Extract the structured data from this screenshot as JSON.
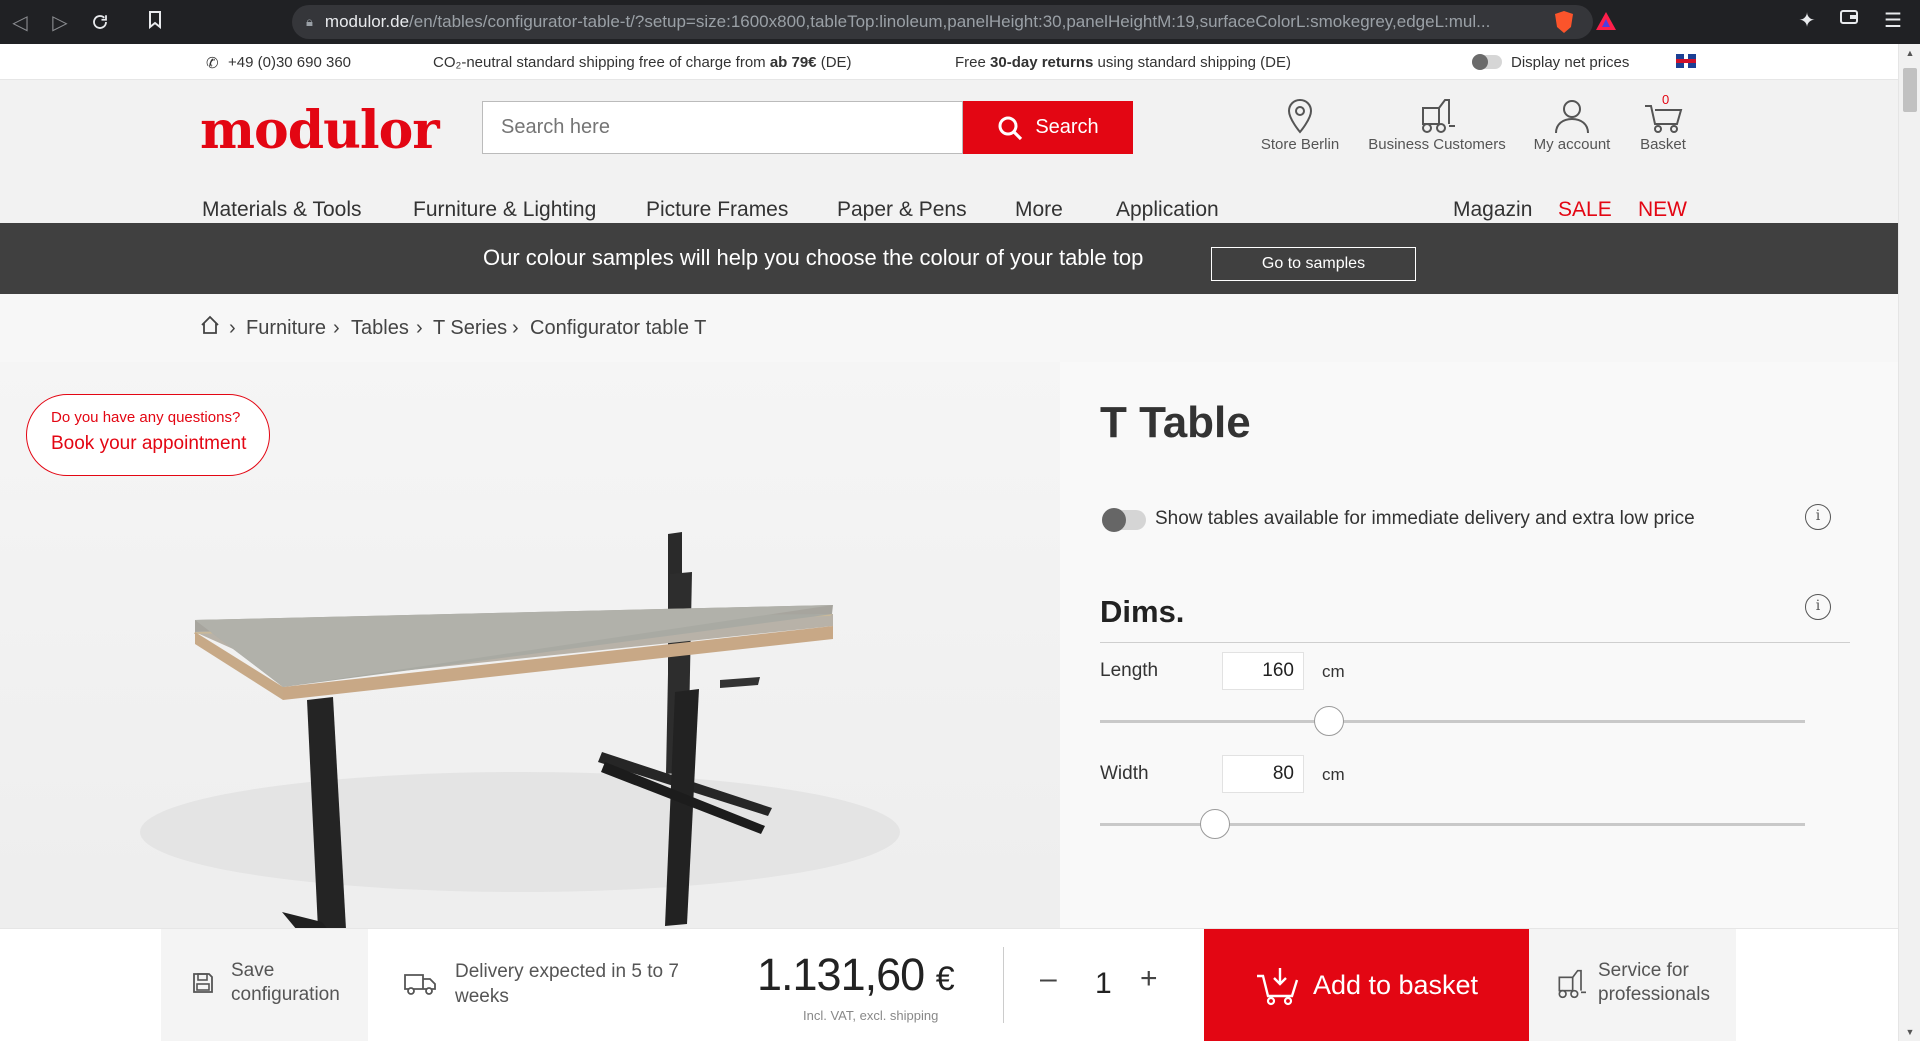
{
  "browser": {
    "url_host": "modulor.de",
    "url_path": "/en/tables/configurator-table-t/?setup=size:1600x800,tableTop:linoleum,panelHeight:30,panelHeightM:19,surfaceColorL:smokegrey,edgeL:mul..."
  },
  "topbar": {
    "phone": "+49 (0)30 690 360",
    "shipping_pre": "CO₂-neutral standard shipping free of charge from ",
    "shipping_bold": "ab 79€",
    "shipping_post": " (DE)",
    "returns_pre": "Free ",
    "returns_bold": "30-day returns",
    "returns_post": " using standard shipping (DE)",
    "net_prices": "Display net prices"
  },
  "header": {
    "logo": "modulor",
    "search_placeholder": "Search here",
    "search_button": "Search",
    "icons": [
      {
        "label": "Store Berlin",
        "icon": "location-pin-icon"
      },
      {
        "label": "Business Customers",
        "icon": "forklift-icon"
      },
      {
        "label": "My account",
        "icon": "user-icon"
      },
      {
        "label": "Basket",
        "icon": "cart-icon",
        "count": "0"
      }
    ]
  },
  "menu": {
    "items": [
      "Materials & Tools",
      "Furniture & Lighting",
      "Picture Frames",
      "Paper & Pens",
      "More",
      "Application"
    ],
    "right": [
      "Magazin",
      "SALE",
      "NEW"
    ]
  },
  "banner": {
    "text": "Our colour samples will help you choose the colour of your table top",
    "button": "Go to samples"
  },
  "breadcrumb": [
    "Furniture",
    "Tables",
    "T Series",
    "Configurator table T"
  ],
  "appointment": {
    "question": "Do you have any questions?",
    "link": "Book your appointment"
  },
  "product": {
    "title": "T Table",
    "toggle_label": "Show tables available for immediate delivery and extra low price",
    "section": "Dims.",
    "fields": [
      {
        "label": "Length",
        "value": "160",
        "unit": "cm",
        "slider_fraction": 0.325
      },
      {
        "label": "Width",
        "value": "80",
        "unit": "cm",
        "slider_fraction": 0.163
      }
    ]
  },
  "bottom": {
    "save": "Save configuration",
    "delivery": "Delivery expected in 5 to 7 weeks",
    "price": "1.131,60",
    "currency": "€",
    "price_note": "Incl. VAT, excl. shipping",
    "quantity": "1",
    "minus": "–",
    "plus": "+",
    "add_to_basket": "Add to basket",
    "service": "Service for professionals"
  },
  "colors": {
    "brand_red": "#e30613",
    "banner_bg": "#404040"
  }
}
